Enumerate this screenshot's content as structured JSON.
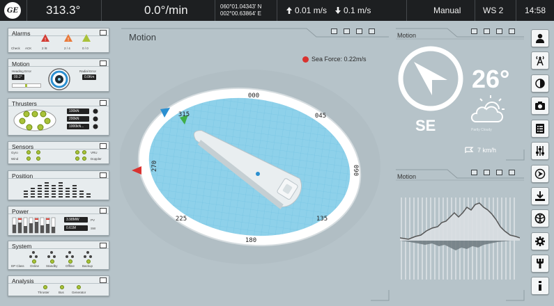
{
  "topbar": {
    "logo": "GE",
    "heading": "313.3°",
    "rot": "0.0°/min",
    "lat": "060°01.04343' N",
    "lon": "002°00.63864' E",
    "speed_up": "0.01 m/s",
    "speed_down": "0.1 m/s",
    "mode": "Manual",
    "workstation": "WS 2",
    "time": "14:58"
  },
  "left_panels": {
    "alarms": {
      "title": "Alarms",
      "labels": [
        "Check",
        "ACK",
        "2 /8",
        "2 / 4",
        "0 / 0"
      ]
    },
    "motion": {
      "title": "Motion",
      "heading_label": "Heading Error",
      "heading_value": "00.2°",
      "radial_label": "Radial Error",
      "radial_value": "0.0Km"
    },
    "thrusters": {
      "title": "Thrusters",
      "values": [
        "100kN",
        "200kN",
        "1000kN..."
      ]
    },
    "sensors": {
      "title": "Sensors",
      "labels": [
        "Gyro",
        "Wind",
        "VRU",
        "Doppler"
      ]
    },
    "position": {
      "title": "Position"
    },
    "power": {
      "title": "Power",
      "pv_value": "3.98MW",
      "pv_label": "PV",
      "sw_value": "0.61M",
      "sw_label": "SW"
    },
    "system": {
      "title": "System",
      "labels": [
        "DP Class",
        "Online",
        "Standby",
        "Offline",
        "Backup"
      ]
    },
    "analysis": {
      "title": "Analysis",
      "labels": [
        "Thruster",
        "Bus",
        "Generator"
      ]
    }
  },
  "main": {
    "title": "Motion",
    "sea_force": "Sea Force: 0.22m/s",
    "compass_labels": [
      "000",
      "045",
      "090",
      "135",
      "180",
      "225",
      "270",
      "315"
    ]
  },
  "weather": {
    "title": "Motion",
    "direction": "SE",
    "temperature": "26°",
    "condition": "Partly Cloudy",
    "wind": "7 km/h"
  },
  "chart_panel": {
    "title": "Motion"
  },
  "sidebar": {
    "buttons": [
      "user-icon",
      "antenna-icon",
      "contrast-icon",
      "camera-icon",
      "list-icon",
      "sliders-icon",
      "navigate-icon",
      "download-icon",
      "thruster-icon",
      "gear-icon",
      "wrench-icon",
      "info-icon"
    ]
  },
  "colors": {
    "background": "#b6c3c9",
    "water": "#8ed1ea",
    "sea_force": "#d9322f",
    "accent_green": "#a9c23a",
    "accent_blue": "#2b8fd0"
  }
}
